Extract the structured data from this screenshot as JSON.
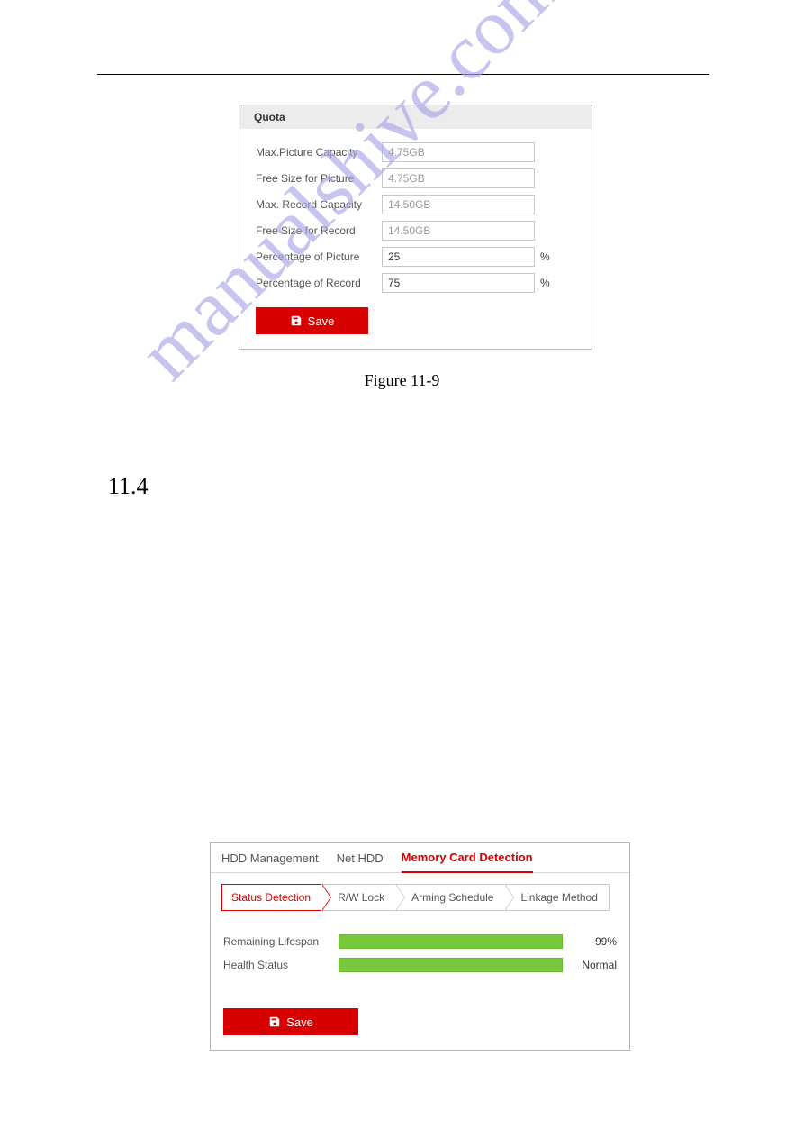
{
  "watermark": "manualshive.com",
  "figure_caption": "Figure 11-9",
  "section_number": "11.4",
  "quota": {
    "title": "Quota",
    "rows": [
      {
        "label": "Max.Picture Capacity",
        "value": "4.75GB",
        "editable": false,
        "unit": ""
      },
      {
        "label": "Free Size for Picture",
        "value": "4.75GB",
        "editable": false,
        "unit": ""
      },
      {
        "label": "Max. Record Capacity",
        "value": "14.50GB",
        "editable": false,
        "unit": ""
      },
      {
        "label": "Free Size for Record",
        "value": "14.50GB",
        "editable": false,
        "unit": ""
      },
      {
        "label": "Percentage of Picture",
        "value": "25",
        "editable": true,
        "unit": "%"
      },
      {
        "label": "Percentage of Record",
        "value": "75",
        "editable": true,
        "unit": "%"
      }
    ],
    "save_label": "Save"
  },
  "card": {
    "tabs": [
      "HDD Management",
      "Net HDD",
      "Memory Card Detection"
    ],
    "active_tab": 2,
    "chevrons": [
      "Status Detection",
      "R/W Lock",
      "Arming Schedule",
      "Linkage Method"
    ],
    "active_chevron": 0,
    "status": [
      {
        "label": "Remaining Lifespan",
        "percent": 99,
        "display": "99%"
      },
      {
        "label": "Health Status",
        "percent": 100,
        "display": "Normal"
      }
    ],
    "save_label": "Save"
  }
}
